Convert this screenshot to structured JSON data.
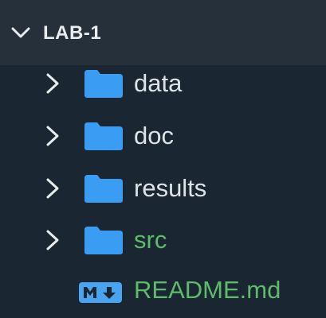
{
  "explorer": {
    "title": "LAB-1",
    "items": [
      {
        "label": "data",
        "type": "folder",
        "color": "#dde4e8",
        "icon": "folder-icon"
      },
      {
        "label": "doc",
        "type": "folder",
        "color": "#dde4e8",
        "icon": "folder-icon"
      },
      {
        "label": "results",
        "type": "folder",
        "color": "#dde4e8",
        "icon": "folder-icon"
      },
      {
        "label": "src",
        "type": "folder",
        "color": "#5dbb6a",
        "icon": "folder-icon"
      },
      {
        "label": "README.md",
        "type": "file",
        "color": "#5dbb6a",
        "icon": "markdown-icon"
      }
    ]
  },
  "colors": {
    "background": "#1a2631",
    "header_background": "#25303a",
    "folder_blue": "#3a9cf2",
    "modified_green": "#5dbb6a",
    "markdown_blue": "#4aa3ee"
  }
}
